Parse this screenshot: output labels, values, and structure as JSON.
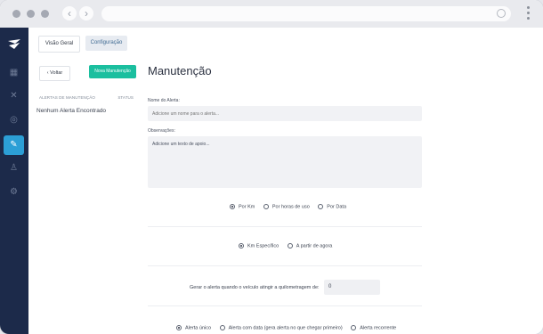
{
  "browser": {
    "back_icon": "arrow-left-icon",
    "forward_icon": "arrow-right-icon",
    "search_icon": "search-icon",
    "menu_icon": "kebab-icon"
  },
  "sidebar": {
    "items": [
      "dashboard-icon",
      "route-icon",
      "tracking-icon",
      "wrench-icon",
      "user-icon",
      "gear-icon"
    ],
    "active_color": "#2c9fd6",
    "bg_color": "#1c2a4a"
  },
  "tabs": {
    "overview": "Visão Geral",
    "config": "Configuração"
  },
  "list": {
    "back": "Voltar",
    "new_button": "Nova Manutenção",
    "header_alerts": "ALERTAS DE MANUTENÇÃO",
    "header_status": "STATUS",
    "empty": "Nenhum Alerta Encontrado"
  },
  "form": {
    "title": "Manutenção",
    "alert_name_label": "Nome do Alerta:",
    "alert_name_placeholder": "Adicione um nome para o alerta...",
    "notes_label": "Observações:",
    "notes_placeholder": "Adicione um texto de apoio...",
    "mode_options": [
      "Por Km",
      "Por horas de uso",
      "Por Data"
    ],
    "km_options": [
      "Km Específico",
      "A partir de agora"
    ],
    "km_prompt": "Gerar o alerta quando o veículo atingir a quilometragem de:",
    "km_value": "0",
    "recurrence_options": [
      "Alerta único",
      "Alerta com data (gera alerta no que chegar primeiro)",
      "Alerta recorrente"
    ]
  },
  "accent": {
    "primary": "#1bbf9f"
  }
}
